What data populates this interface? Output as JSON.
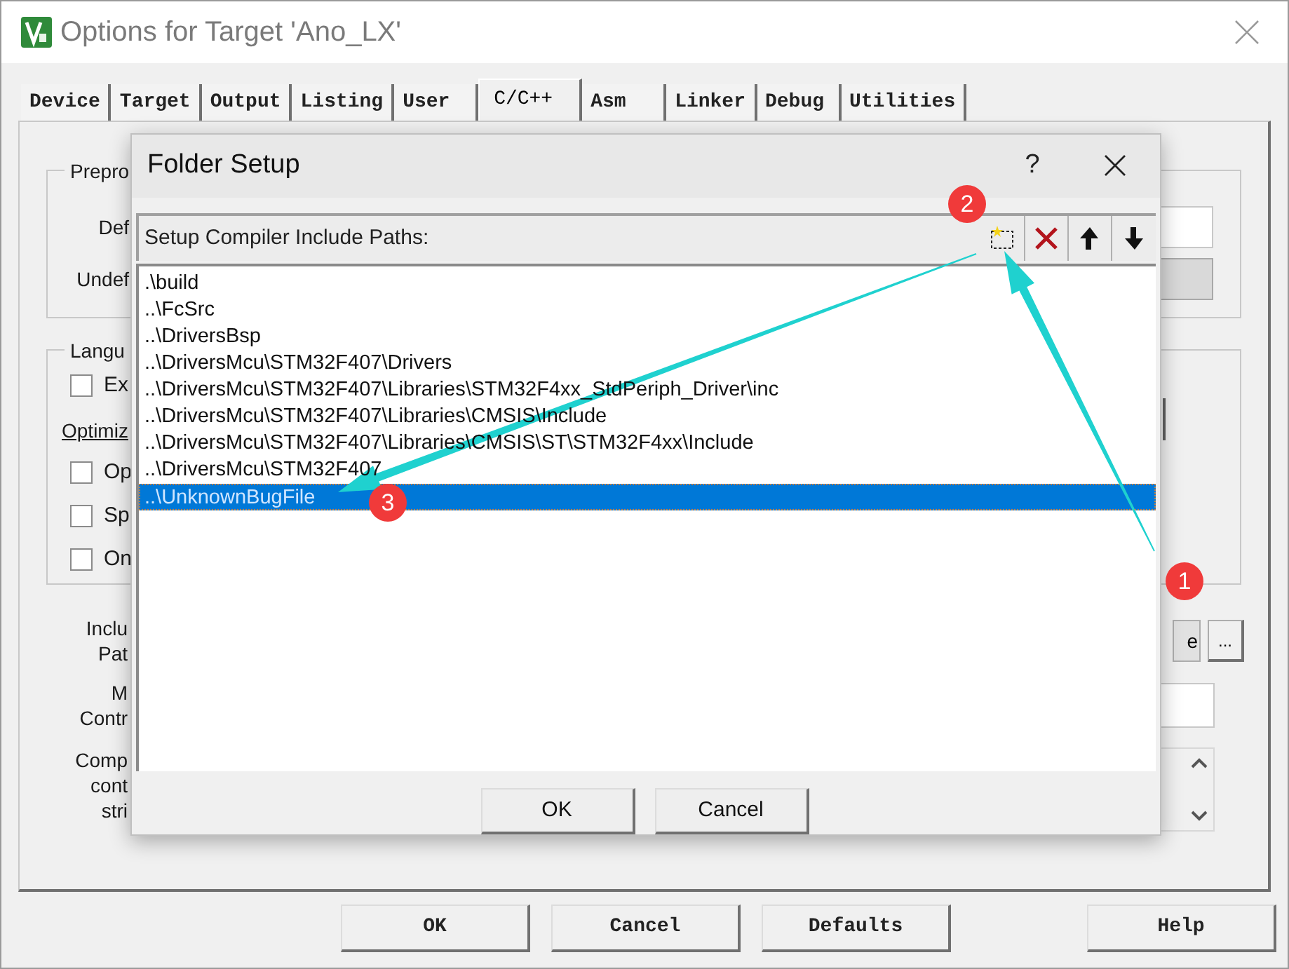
{
  "window": {
    "title": "Options for Target 'Ano_LX'"
  },
  "tabs": [
    {
      "label": "Device",
      "selected": false
    },
    {
      "label": "Target",
      "selected": false
    },
    {
      "label": "Output",
      "selected": false
    },
    {
      "label": "Listing",
      "selected": false
    },
    {
      "label": "User",
      "selected": false
    },
    {
      "label": "C/C++",
      "selected": true
    },
    {
      "label": "Asm",
      "selected": false
    },
    {
      "label": "Linker",
      "selected": false
    },
    {
      "label": "Debug",
      "selected": false
    },
    {
      "label": "Utilities",
      "selected": false
    }
  ],
  "preprocessor": {
    "title": "Prepro",
    "rows": [
      {
        "label": "Def",
        "disabled": false
      },
      {
        "label": "Undef",
        "disabled": true
      }
    ]
  },
  "language": {
    "title": "Langu",
    "items": [
      {
        "kind": "checkbox",
        "label": "Ex",
        "checked": false
      },
      {
        "kind": "label",
        "label": "Optimiz"
      },
      {
        "kind": "checkbox",
        "label": "Op",
        "checked": false
      },
      {
        "kind": "checkbox",
        "label": "Sp",
        "checked": false
      },
      {
        "kind": "checkbox",
        "label": "On",
        "checked": false
      }
    ]
  },
  "include_paths": {
    "label_lines": [
      "Inclu",
      "Pat"
    ],
    "button": "e",
    "browse": "..."
  },
  "misc_controls": {
    "label_lines": [
      "M",
      "Contr"
    ]
  },
  "compiler_control": {
    "label_lines": [
      "Comp",
      "cont",
      "stri"
    ]
  },
  "buttons": [
    "OK",
    "Cancel",
    "Defaults",
    "Help"
  ],
  "dialog": {
    "title": "Folder Setup",
    "help": "?",
    "header": "Setup Compiler Include Paths:",
    "paths": [
      {
        "text": ".\\build",
        "selected": false
      },
      {
        "text": "..\\FcSrc",
        "selected": false
      },
      {
        "text": "..\\DriversBsp",
        "selected": false
      },
      {
        "text": "..\\DriversMcu\\STM32F407\\Drivers",
        "selected": false
      },
      {
        "text": "..\\DriversMcu\\STM32F407\\Libraries\\STM32F4xx_StdPeriph_Driver\\inc",
        "selected": false
      },
      {
        "text": "..\\DriversMcu\\STM32F407\\Libraries\\CMSIS\\Include",
        "selected": false
      },
      {
        "text": "..\\DriversMcu\\STM32F407\\Libraries\\CMSIS\\ST\\STM32F4xx\\Include",
        "selected": false
      },
      {
        "text": "..\\DriversMcu\\STM32F407",
        "selected": false
      },
      {
        "text": "..\\UnknownBugFile",
        "selected": true
      }
    ],
    "buttons": [
      "OK",
      "Cancel"
    ]
  },
  "annotations": [
    "1",
    "2",
    "3"
  ]
}
